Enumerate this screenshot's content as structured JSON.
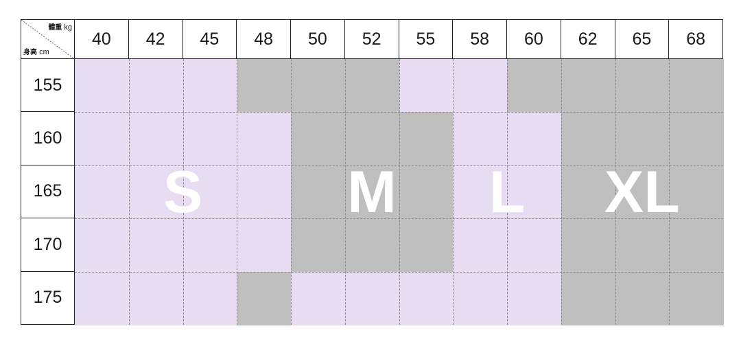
{
  "corner": {
    "weight_label": "體重",
    "weight_unit": "kg",
    "height_label": "身高",
    "height_unit": "cm"
  },
  "weights": [
    "40",
    "42",
    "45",
    "48",
    "50",
    "52",
    "55",
    "58",
    "60",
    "62",
    "65",
    "68"
  ],
  "heights": [
    "155",
    "160",
    "165",
    "170",
    "175"
  ],
  "grid": [
    [
      "S",
      "S",
      "S",
      "M",
      "M",
      "M",
      "L",
      "L",
      "XL",
      "XL",
      "XL",
      "XL"
    ],
    [
      "S",
      "S",
      "S",
      "S",
      "M",
      "M",
      "M",
      "L",
      "L",
      "XL",
      "XL",
      "XL"
    ],
    [
      "S",
      "S",
      "S",
      "S",
      "M",
      "M",
      "M",
      "L",
      "L",
      "XL",
      "XL",
      "XL"
    ],
    [
      "S",
      "S",
      "S",
      "S",
      "M",
      "M",
      "M",
      "L",
      "L",
      "XL",
      "XL",
      "XL"
    ],
    [
      "S",
      "S",
      "S",
      "M",
      "L",
      "L",
      "L",
      "L",
      "L",
      "XL",
      "XL",
      "XL"
    ]
  ],
  "sizes": {
    "S": {
      "label": "S",
      "color": "#e8dcf2"
    },
    "M": {
      "label": "M",
      "color": "#bfbfbf"
    },
    "L": {
      "label": "L",
      "color": "#e8dcf2"
    },
    "XL": {
      "label": "XL",
      "color": "#bfbfbf"
    }
  }
}
